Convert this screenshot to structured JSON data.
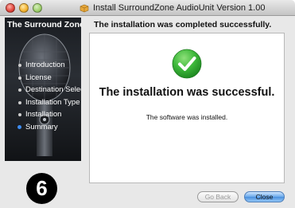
{
  "window": {
    "title": "Install SurroundZone AudioUnit Version 1.00"
  },
  "sidebar": {
    "title": "The Surround Zone",
    "steps": [
      {
        "label": "Introduction",
        "state": "done"
      },
      {
        "label": "License",
        "state": "done"
      },
      {
        "label": "Destination Select",
        "state": "done"
      },
      {
        "label": "Installation Type",
        "state": "done"
      },
      {
        "label": "Installation",
        "state": "done"
      },
      {
        "label": "Summary",
        "state": "current"
      }
    ]
  },
  "badge": {
    "number": "6"
  },
  "main": {
    "heading": "The installation was completed successfully.",
    "success_message": "The installation was successful.",
    "detail_message": "The software was installed."
  },
  "buttons": {
    "go_back": "Go Back",
    "close": "Close"
  },
  "colors": {
    "check_green": "#3db83a",
    "current_step": "#3d8cf0",
    "close_button": "#6aa9ea"
  }
}
